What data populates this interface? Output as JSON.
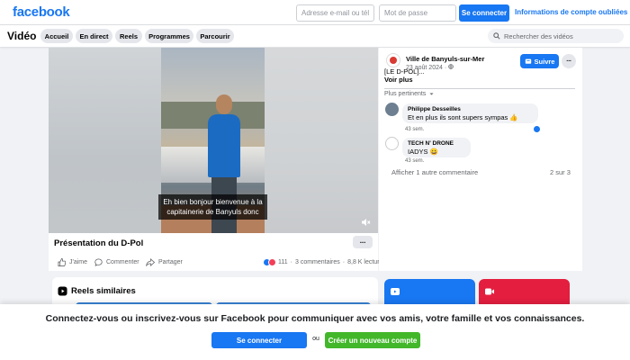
{
  "brand": {
    "name": "facebook",
    "color": "#1877f2"
  },
  "top_login": {
    "email_placeholder": "Adresse e-mail ou téléphone",
    "password_placeholder": "Mot de passe",
    "login_label": "Se connecter",
    "forgot_label": "Informations de compte oubliées ?"
  },
  "video_nav": {
    "title": "Vidéo",
    "tabs": [
      {
        "label": "Accueil"
      },
      {
        "label": "En direct"
      },
      {
        "label": "Reels"
      },
      {
        "label": "Programmes"
      },
      {
        "label": "Parcourir"
      }
    ],
    "search_placeholder": "Rechercher des vidéos"
  },
  "video": {
    "subtitle": "Eh bien bonjour bienvenue à la capitainerie de Banyuls donc",
    "title": "Présentation du D-Pol",
    "more_label": "···",
    "actions": {
      "like": "J'aime",
      "comment": "Commenter",
      "share": "Partager"
    },
    "reaction_count": "111",
    "comments_count": "3 commentaires",
    "views": "8,8 K lectures"
  },
  "side_panel": {
    "page_name": "Ville de Banyuls-sur-Mer",
    "date": "23 août 2024 · ",
    "caption": "[LE D-POL]...",
    "see_more": "Voir plus",
    "follow_label": "Suivre",
    "more_label": "···",
    "sort_label": "Plus pertinents",
    "comments": [
      {
        "author": "Philippe Desseilles",
        "text": "Et en plus ils sont supers sympas 👍",
        "time": "43 sem."
      },
      {
        "author": "TECH N' DRONE",
        "text": "IADYS 😀",
        "time": "43 sem."
      }
    ],
    "more_comments": "Afficher 1 autre commentaire",
    "count": "2 sur 3"
  },
  "reels": {
    "title": "Reels similaires"
  },
  "banner": {
    "text": "Connectez-vous ou inscrivez-vous sur Facebook pour communiquer avec vos amis, votre famille et vos connaissances.",
    "login_label": "Se connecter",
    "or_label": "ou",
    "signup_label": "Créer un nouveau compte"
  }
}
